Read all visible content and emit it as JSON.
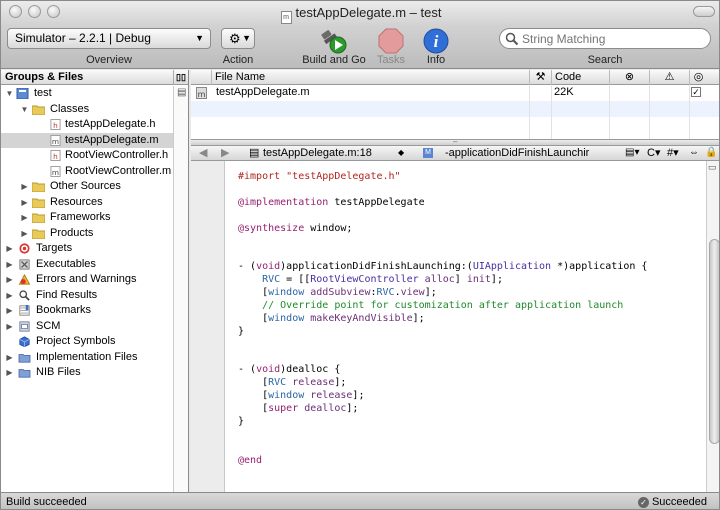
{
  "window": {
    "title": "testAppDelegate.m – test"
  },
  "toolbar": {
    "overview_value": "Simulator – 2.2.1 | Debug",
    "overview_label": "Overview",
    "action_label": "Action",
    "build_label": "Build and Go",
    "tasks_label": "Tasks",
    "info_label": "Info",
    "search_placeholder": "String Matching",
    "search_label": "Search"
  },
  "sidebar": {
    "header": "Groups & Files",
    "items": [
      {
        "label": "test",
        "icon": "project-icon"
      },
      {
        "label": "Classes",
        "icon": "folder-icon"
      },
      {
        "label": "testAppDelegate.h",
        "icon": "header-file-icon"
      },
      {
        "label": "testAppDelegate.m",
        "icon": "source-file-icon"
      },
      {
        "label": "RootViewController.h",
        "icon": "header-file-icon"
      },
      {
        "label": "RootViewController.m",
        "icon": "source-file-icon"
      },
      {
        "label": "Other Sources",
        "icon": "folder-icon"
      },
      {
        "label": "Resources",
        "icon": "folder-icon"
      },
      {
        "label": "Frameworks",
        "icon": "folder-icon"
      },
      {
        "label": "Products",
        "icon": "folder-icon"
      },
      {
        "label": "Targets",
        "icon": "target-icon"
      },
      {
        "label": "Executables",
        "icon": "executable-icon"
      },
      {
        "label": "Errors and Warnings",
        "icon": "warning-icon"
      },
      {
        "label": "Find Results",
        "icon": "magnifier-icon"
      },
      {
        "label": "Bookmarks",
        "icon": "bookmark-icon"
      },
      {
        "label": "SCM",
        "icon": "scm-icon"
      },
      {
        "label": "Project Symbols",
        "icon": "cube-icon"
      },
      {
        "label": "Implementation Files",
        "icon": "smart-group-icon"
      },
      {
        "label": "NIB Files",
        "icon": "smart-group-icon"
      }
    ]
  },
  "file_list": {
    "headers": {
      "file_name": "File Name",
      "code": "Code"
    },
    "rows": [
      {
        "name": "testAppDelegate.m",
        "code": "22K"
      }
    ]
  },
  "navbar": {
    "file": "testAppDelegate.m:18",
    "symbol": "-applicationDidFinishLaunchir",
    "c_menu": "C",
    "hash_menu": "#"
  },
  "code_lines": [
    [
      [
        "s",
        "#import \"testAppDelegate.h\""
      ]
    ],
    [],
    [
      [
        "k",
        "@implementation"
      ],
      [
        "n",
        " testAppDelegate"
      ]
    ],
    [],
    [
      [
        "k",
        "@synthesize"
      ],
      [
        "n",
        " window;"
      ]
    ],
    [],
    [],
    [
      [
        "n",
        "- ("
      ],
      [
        "k",
        "void"
      ],
      [
        "n",
        ")applicationDidFinishLaunching:("
      ],
      [
        "t",
        "UIApplication"
      ],
      [
        "n",
        " *)application {"
      ]
    ],
    [
      [
        "n",
        "    "
      ],
      [
        "p",
        "RVC"
      ],
      [
        "n",
        " = [["
      ],
      [
        "t",
        "RootViewController"
      ],
      [
        "n",
        " "
      ],
      [
        "m",
        "alloc"
      ],
      [
        "n",
        "] "
      ],
      [
        "m",
        "init"
      ],
      [
        "n",
        "];"
      ]
    ],
    [
      [
        "n",
        "    ["
      ],
      [
        "p",
        "window"
      ],
      [
        "n",
        " "
      ],
      [
        "m",
        "addSubview"
      ],
      [
        "n",
        ":"
      ],
      [
        "p",
        "RVC"
      ],
      [
        "n",
        "."
      ],
      [
        "m",
        "view"
      ],
      [
        "n",
        "];"
      ]
    ],
    [
      [
        "n",
        "    "
      ],
      [
        "c",
        "// Override point for customization after application launch"
      ]
    ],
    [
      [
        "n",
        "    ["
      ],
      [
        "p",
        "window"
      ],
      [
        "n",
        " "
      ],
      [
        "m",
        "makeKeyAndVisible"
      ],
      [
        "n",
        "];"
      ]
    ],
    [
      [
        "n",
        "}"
      ]
    ],
    [],
    [],
    [
      [
        "n",
        "- ("
      ],
      [
        "k",
        "void"
      ],
      [
        "n",
        ")dealloc {"
      ]
    ],
    [
      [
        "n",
        "    ["
      ],
      [
        "p",
        "RVC"
      ],
      [
        "n",
        " "
      ],
      [
        "m",
        "release"
      ],
      [
        "n",
        "];"
      ]
    ],
    [
      [
        "n",
        "    ["
      ],
      [
        "p",
        "window"
      ],
      [
        "n",
        " "
      ],
      [
        "m",
        "release"
      ],
      [
        "n",
        "];"
      ]
    ],
    [
      [
        "n",
        "    ["
      ],
      [
        "k",
        "super"
      ],
      [
        "n",
        " "
      ],
      [
        "m",
        "dealloc"
      ],
      [
        "n",
        "];"
      ]
    ],
    [
      [
        "n",
        "}"
      ]
    ],
    [],
    [],
    [
      [
        "k",
        "@end"
      ]
    ]
  ],
  "status": {
    "left": "Build succeeded",
    "right": "Succeeded"
  }
}
